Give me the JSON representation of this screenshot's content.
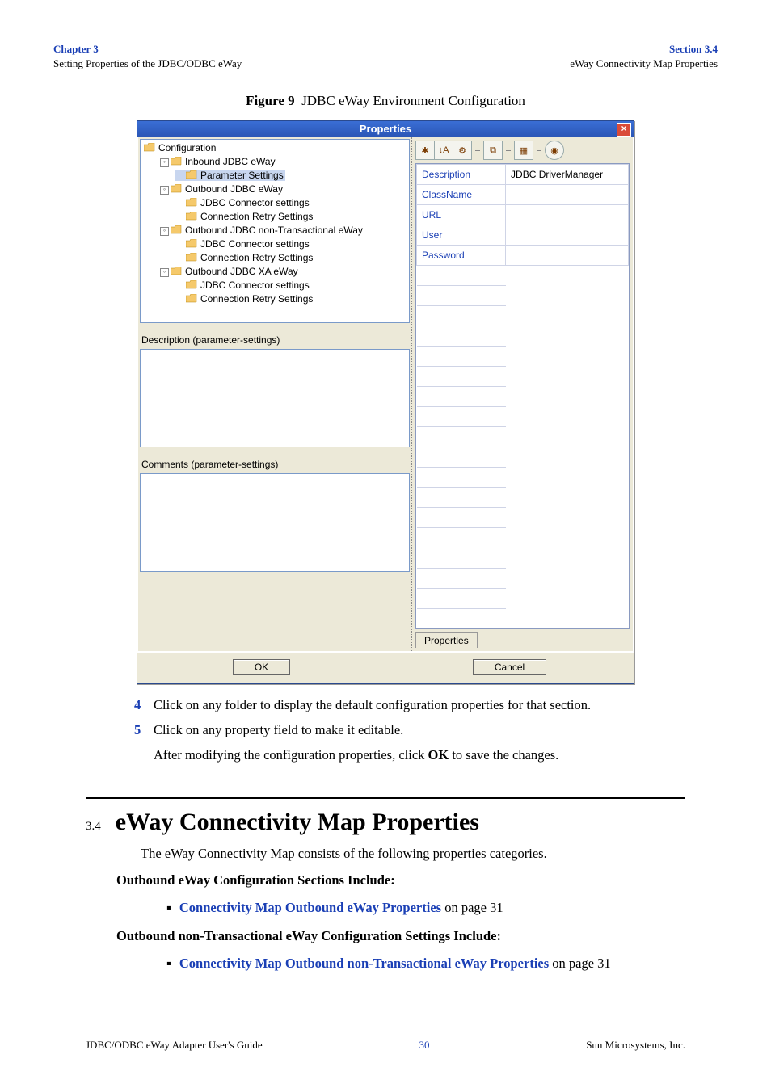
{
  "header": {
    "chapter": "Chapter 3",
    "chapter_sub": "Setting Properties of the JDBC/ODBC eWay",
    "section": "Section 3.4",
    "section_sub": "eWay Connectivity Map Properties"
  },
  "figure": {
    "label": "Figure 9",
    "caption": "JDBC eWay Environment Configuration"
  },
  "dialog": {
    "title": "Properties",
    "close_glyph": "×",
    "tree": {
      "root": "Configuration",
      "nodes": [
        {
          "label": "Inbound JDBC eWay",
          "expanded": true,
          "children": [
            {
              "label": "Parameter Settings",
              "selected": true
            }
          ]
        },
        {
          "label": "Outbound JDBC eWay",
          "expanded": true,
          "children": [
            {
              "label": "JDBC Connector settings"
            },
            {
              "label": "Connection Retry Settings"
            }
          ]
        },
        {
          "label": "Outbound JDBC non-Transactional eWay",
          "expanded": true,
          "children": [
            {
              "label": "JDBC Connector settings"
            },
            {
              "label": "Connection Retry Settings"
            }
          ]
        },
        {
          "label": "Outbound JDBC XA eWay",
          "expanded": true,
          "children": [
            {
              "label": "JDBC Connector settings"
            },
            {
              "label": "Connection Retry Settings"
            }
          ]
        }
      ]
    },
    "desc_label": "Description (parameter-settings)",
    "comm_label": "Comments (parameter-settings)",
    "toolbar_icons": [
      "categorized-icon",
      "sort-alpha-icon",
      "show-advanced-icon",
      "filter-icon",
      "expand-icon",
      "help-icon"
    ],
    "props": [
      {
        "name": "Description",
        "value": "JDBC DriverManager"
      },
      {
        "name": "ClassName",
        "value": ""
      },
      {
        "name": "URL",
        "value": ""
      },
      {
        "name": "User",
        "value": ""
      },
      {
        "name": "Password",
        "value": ""
      }
    ],
    "bottom_tab": "Properties",
    "ok": "OK",
    "cancel": "Cancel"
  },
  "steps": [
    {
      "n": "4",
      "t": "Click on any folder to display the default configuration properties for that section."
    },
    {
      "n": "5",
      "t": "Click on any property field to make it editable."
    }
  ],
  "cont_text_a": "After modifying the configuration properties, click ",
  "cont_bold": "OK",
  "cont_text_b": " to save the changes.",
  "section34": {
    "num": "3.4",
    "title": "eWay Connectivity Map Properties",
    "intro": "The eWay Connectivity Map consists of the following properties categories.",
    "h1": "Outbound eWay Configuration Sections Include:",
    "b1_link": "Connectivity Map Outbound eWay Properties",
    "b1_tail": " on page 31",
    "h2": "Outbound non-Transactional eWay Configuration Settings Include:",
    "b2_link": "Connectivity Map Outbound non-Transactional eWay Properties",
    "b2_tail": " on page 31"
  },
  "footer": {
    "left": "JDBC/ODBC eWay Adapter User's Guide",
    "page": "30",
    "right": "Sun Microsystems, Inc."
  }
}
